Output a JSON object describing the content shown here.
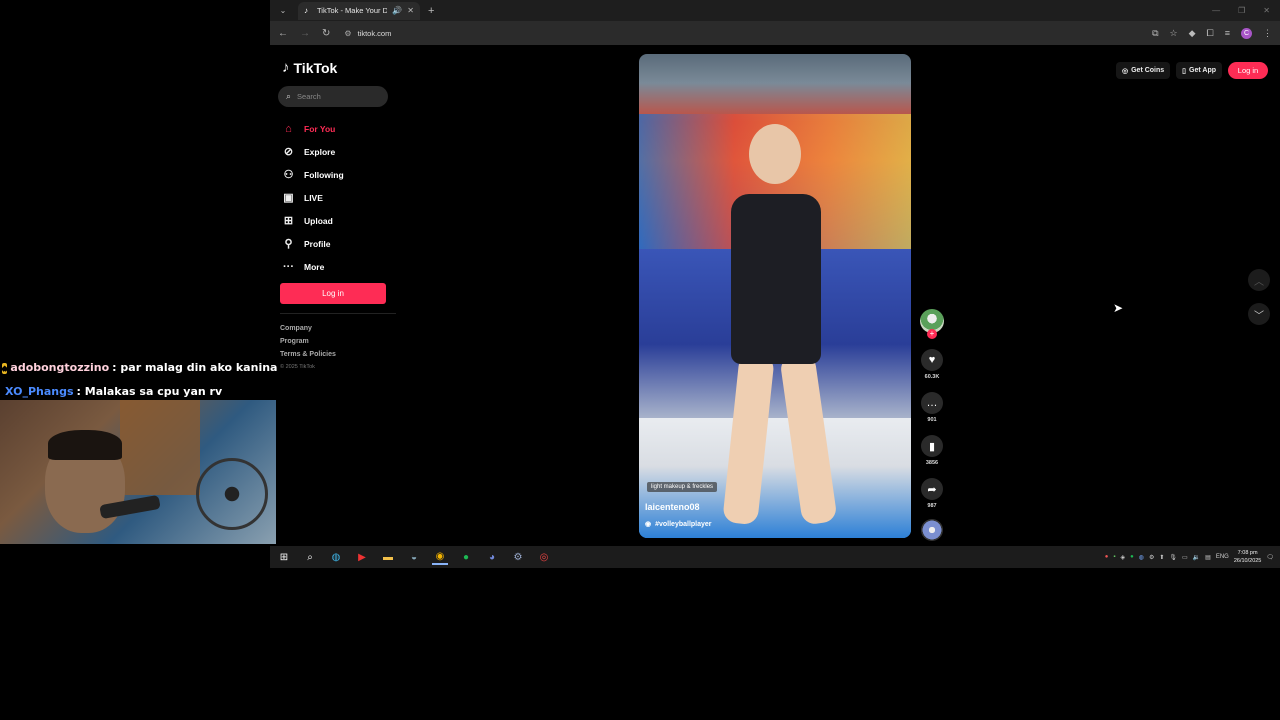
{
  "browser": {
    "tab_title": "TikTok - Make Your Day",
    "url": "tiktok.com"
  },
  "tiktok": {
    "logo_text": "TikTok",
    "search_placeholder": "Search",
    "nav": [
      {
        "label": "For You",
        "icon": "home-icon"
      },
      {
        "label": "Explore",
        "icon": "compass-icon"
      },
      {
        "label": "Following",
        "icon": "following-icon"
      },
      {
        "label": "LIVE",
        "icon": "live-icon"
      },
      {
        "label": "Upload",
        "icon": "upload-icon"
      },
      {
        "label": "Profile",
        "icon": "profile-icon"
      },
      {
        "label": "More",
        "icon": "more-icon"
      }
    ],
    "login_label": "Log in",
    "footer": [
      "Company",
      "Program",
      "Terms & Policies"
    ],
    "copyright": "© 2025 TikTok",
    "top_actions": {
      "get_coins": "Get Coins",
      "get_app": "Get App",
      "login": "Log in"
    },
    "video": {
      "tag": "light makeup & freckles",
      "author": "laicenteno08",
      "hashtag": "#volleyballplayer",
      "likes": "60.3K",
      "comments": "901",
      "saves": "3856",
      "shares": "987"
    },
    "accent_color": "#fe2c55"
  },
  "taskbar": {
    "time": "7:08 pm",
    "date": "26/10/2025",
    "lang": "ENG"
  },
  "chat": [
    {
      "user": "adobongtozzino",
      "message": ": par malag din ako kanina"
    },
    {
      "user": "XO_Phangs",
      "message": ": Malakas sa cpu yan rv"
    }
  ]
}
